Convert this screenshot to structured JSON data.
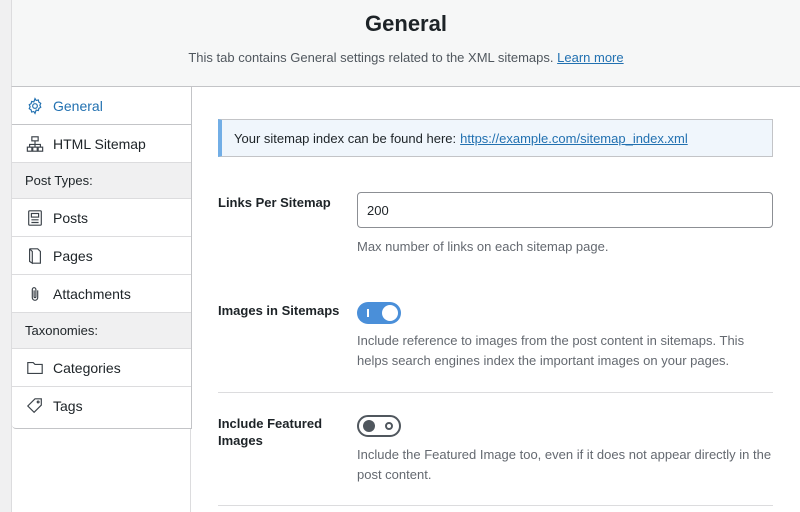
{
  "header": {
    "title": "General",
    "subtitle": "This tab contains General settings related to the XML sitemaps.",
    "learn_more": "Learn more"
  },
  "sidebar": {
    "items": [
      {
        "label": "General",
        "icon": "gear-icon",
        "active": true
      },
      {
        "label": "HTML Sitemap",
        "icon": "sitemap-icon"
      }
    ],
    "post_types_heading": "Post Types:",
    "post_types": [
      {
        "label": "Posts",
        "icon": "document-icon"
      },
      {
        "label": "Pages",
        "icon": "page-icon"
      },
      {
        "label": "Attachments",
        "icon": "paperclip-icon"
      }
    ],
    "taxonomies_heading": "Taxonomies:",
    "taxonomies": [
      {
        "label": "Categories",
        "icon": "folder-icon"
      },
      {
        "label": "Tags",
        "icon": "tag-icon"
      }
    ]
  },
  "notice": {
    "text": "Your sitemap index can be found here:",
    "link": "https://example.com/sitemap_index.xml"
  },
  "settings": {
    "links_per_sitemap": {
      "label": "Links Per Sitemap",
      "value": "200",
      "description": "Max number of links on each sitemap page."
    },
    "images_in_sitemaps": {
      "label": "Images in Sitemaps",
      "enabled": true,
      "description": "Include reference to images from the post content in sitemaps. This helps search engines index the important images on your pages."
    },
    "include_featured_images": {
      "label": "Include Featured Images",
      "enabled": false,
      "description": "Include the Featured Image too, even if it does not appear directly in the post content."
    }
  },
  "colors": {
    "accent": "#2271b1",
    "toggle_on": "#4a8fd9",
    "notice_border": "#72aee6"
  }
}
